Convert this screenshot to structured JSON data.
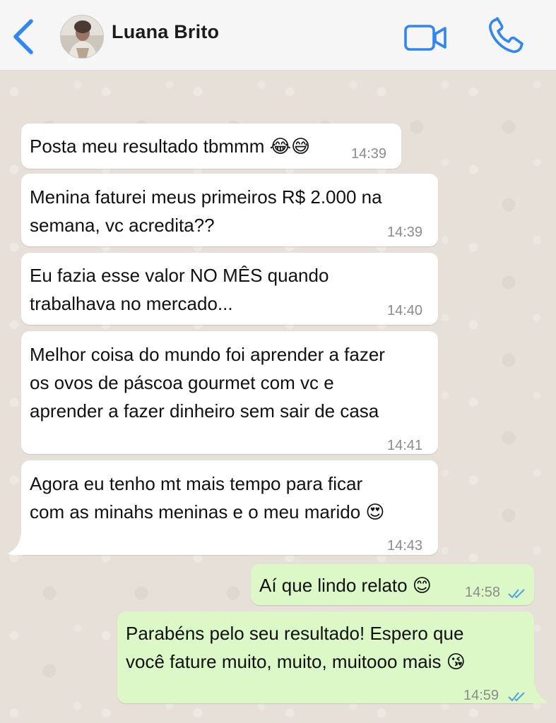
{
  "header": {
    "contact_name": "Luana Brito"
  },
  "icons": {
    "back": "chevron-left-icon",
    "video": "video-call-icon",
    "phone": "phone-call-icon"
  },
  "colors": {
    "accent": "#2f86f6",
    "incoming_bubble": "#ffffff",
    "outgoing_bubble": "#dcf8c6",
    "read_ticks": "#4fa3e0"
  },
  "messages": [
    {
      "direction": "incoming",
      "lines": [
        "Posta meu resultado tbmmm 😂😅"
      ],
      "time": "14:39"
    },
    {
      "direction": "incoming",
      "lines": [
        "Menina faturei meus primeiros R$ 2.000 na",
        "semana, vc acredita??"
      ],
      "time": "14:39"
    },
    {
      "direction": "incoming",
      "lines": [
        "Eu fazia esse valor NO MÊS quando",
        "trabalhava no mercado..."
      ],
      "time": "14:40"
    },
    {
      "direction": "incoming",
      "lines": [
        "Melhor coisa do mundo foi aprender a fazer",
        "os ovos de páscoa gourmet com vc e",
        "aprender a fazer dinheiro sem sair de casa"
      ],
      "time": "14:41"
    },
    {
      "direction": "incoming",
      "lines": [
        "Agora eu tenho mt mais tempo para ficar",
        "com as minahs meninas e o meu marido 😍"
      ],
      "time": "14:43"
    },
    {
      "direction": "outgoing",
      "lines": [
        "Aí que lindo relato 😊"
      ],
      "time": "14:58",
      "status": "read"
    },
    {
      "direction": "outgoing",
      "lines": [
        "Parabéns pelo seu resultado! Espero que",
        "você fature muito, muito, muitooo mais 😘"
      ],
      "time": "14:59",
      "status": "read"
    }
  ]
}
